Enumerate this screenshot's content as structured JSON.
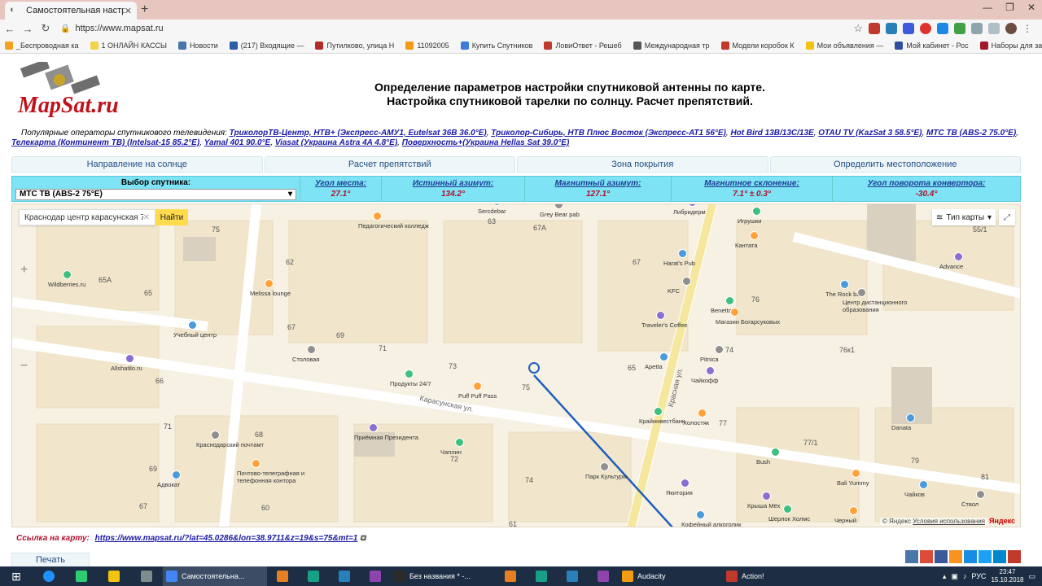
{
  "browser": {
    "tab_title": "Самостоятельная настройка спутниковой",
    "url": "https://www.mapsat.ru",
    "bookmarks": [
      {
        "label": "_Беспроводная ка",
        "color": "#f4a11d"
      },
      {
        "label": "1 ОНЛАЙН КАССЫ",
        "color": "#f2d34c"
      },
      {
        "label": "Новости",
        "color": "#4a76a8"
      },
      {
        "label": "(217) Входящие —",
        "color": "#2d5ca8"
      },
      {
        "label": "Путилково, улица Н",
        "color": "#b12b2b"
      },
      {
        "label": "11092005",
        "color": "#f39c12"
      },
      {
        "label": "Купить Спутников",
        "color": "#3b7dd8"
      },
      {
        "label": "ЛовиОтвет - Решеб",
        "color": "#c0392b"
      },
      {
        "label": "Международная тр",
        "color": "#555555"
      },
      {
        "label": "Модели коробок К",
        "color": "#c0392b"
      },
      {
        "label": "Мои объявления —",
        "color": "#f1c40f"
      },
      {
        "label": "Мой кабинет - Рос",
        "color": "#2e4f9f"
      },
      {
        "label": "Наборы для заточки",
        "color": "#a01a2a"
      }
    ]
  },
  "header": {
    "title_line1": "Определение параметров настройки спутниковой антенны по карте.",
    "title_line2": "Настройка спутниковой тарелки по солнцу. Расчет препятствий.",
    "logo_text": "MapSat.ru"
  },
  "operators": {
    "intro": "Популярные операторы спутникового телевидения:",
    "links": [
      "ТриколорТВ-Центр, НТВ+ (Экспресс-АМУ1, Eutelsat 36B 36.0°E)",
      "Триколор-Сибирь, НТВ Плюс Восток (Экспресс-АТ1 56°E)",
      "Hot Bird 13B/13C/13E",
      "OTAU TV (KazSat 3 58.5°E)",
      "МТС ТВ (ABS-2 75.0°E)",
      "Телекарта (Континент ТВ) (Intelsat-15 85.2°E)",
      "Yamal 401 90.0°E",
      "Viasat (Украина Astra 4A 4.8°E)",
      "Поверхность+(Украина Hellas Sat 39.0°E)"
    ]
  },
  "tabs": [
    {
      "label": "Направление на солнце"
    },
    {
      "label": "Расчет препятствий"
    },
    {
      "label": "Зона покрытия"
    },
    {
      "label": "Определить местоположение"
    }
  ],
  "params": {
    "satellite_label": "Выбор спутника:",
    "satellite_value": "МТС ТВ (ABS-2 75°E)",
    "elevation_label": "Угол места:",
    "elevation_value": "27.1°",
    "true_azimuth_label": "Истинный азимут:",
    "true_azimuth_value": "134.2°",
    "mag_azimuth_label": "Магнитный азимут:",
    "mag_azimuth_value": "127.1°",
    "mag_decl_label": "Магнитное склонение:",
    "mag_decl_value": "7.1° ± 0.3°",
    "converter_label": "Угол поворота конвертора:",
    "converter_value": "-30.4°"
  },
  "map": {
    "search_value": "Краснодар центр карасунская 7",
    "find_label": "Найти",
    "map_type_label": "Тип карты",
    "copyright": "© Яндекс",
    "terms": "Условия использования",
    "yandex": "Яндекс",
    "labels": [
      "Педагогический колледж",
      "Sercdebar",
      "Grey Bear pab",
      "Либридерм",
      "Игрушки",
      "Кантата",
      "Harat's Pub",
      "KFC",
      "Traveler's Coffee",
      "Benetton",
      "Магазин Богарсуковых",
      "The Rock bar",
      "Центр дистанционного образования",
      "Advance",
      "Wildberries.ru",
      "Melissa lounge",
      "Учебный центр",
      "Столовая",
      "Allshatilo.ru",
      "Продукты 24/7",
      "Puff Puff Pass",
      "Apetta",
      "Pitnica",
      "Чайкофф",
      "Крайинвестбанк",
      "Холостяк",
      "Danata",
      "Краснодарский почтамт",
      "Приёмная Президента",
      "Чаплин",
      "Почтово-телеграфная и телефонная контора",
      "Адвокат",
      "Парк Культуры",
      "Якитория",
      "Bush",
      "Bali Yummy",
      "Чайков",
      "Ствол",
      "Крыша Мёх",
      "Шерлок Холмс",
      "Черный",
      "Кофейный алкоголик",
      "Карасунская ул.",
      "Красная ул."
    ],
    "house_numbers": [
      "75",
      "63",
      "67A",
      "67",
      "55/1",
      "62",
      "65A",
      "65",
      "76",
      "67",
      "69",
      "71",
      "73",
      "65",
      "74",
      "76к1",
      "66",
      "75",
      "77",
      "77/1",
      "71",
      "68",
      "72",
      "79",
      "69",
      "81",
      "67",
      "60",
      "74",
      "61"
    ]
  },
  "link_row": {
    "label": "Ссылка на карту:",
    "url": "https://www.mapsat.ru/?lat=45.0286&lon=38.9711&z=19&s=75&mt=1"
  },
  "print_label": "Печать",
  "taskbar": {
    "windows": [
      {
        "label": "Самостоятельна...",
        "color": "#4285f4",
        "active": true
      },
      {
        "label": "Без названия * -...",
        "color": "#2b2b2b",
        "active": false
      },
      {
        "label": "Audacity",
        "color": "#f39c12",
        "active": false
      },
      {
        "label": "Action!",
        "color": "#c0392b",
        "active": false
      }
    ],
    "lang": "РУС",
    "time": "23:47",
    "date": "15.10.2018"
  },
  "colors": {
    "accent_cyan": "#7ee3f4",
    "param_value": "#b2102d",
    "link_blue": "#1a1aa6",
    "azimuth_line": "#1f5fbf"
  }
}
